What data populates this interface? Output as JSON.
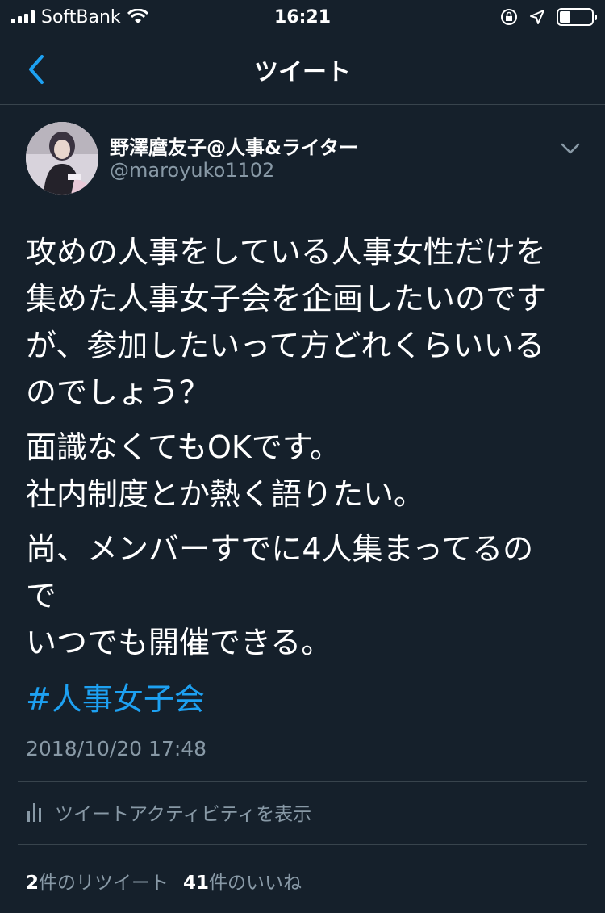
{
  "status_bar": {
    "carrier": "SoftBank",
    "time": "16:21",
    "battery_level": 0.35
  },
  "nav": {
    "title": "ツイート"
  },
  "tweet": {
    "author": {
      "display_name": "野澤麿友子@人事&ライター",
      "handle": "@maroyuko1102"
    },
    "paragraphs": [
      [
        "攻めの人事をしている人事女性だけを",
        "集めた人事女子会を企画したいのです",
        "が、参加したいって方どれくらいいる",
        "のでしょう？"
      ],
      [
        "面識なくてもOKです。",
        "社内制度とか熱く語りたい。"
      ],
      [
        "尚、メンバーすでに4人集まってるの",
        "で",
        "いつでも開催できる。"
      ]
    ],
    "hashtag": "#人事女子会",
    "timestamp": "2018/10/20 17:48",
    "activity_label": "ツイートアクティビティを表示",
    "retweet_count": "2",
    "retweet_label": "件のリツイート",
    "like_count": "41",
    "like_label": "件のいいね"
  },
  "icons": {
    "back": "chevron-left-icon",
    "more": "chevron-down-icon",
    "activity": "bar-chart-icon",
    "wifi": "wifi-icon",
    "orientation_lock": "orientation-lock-icon",
    "location": "location-arrow-icon",
    "battery": "battery-icon"
  },
  "colors": {
    "background": "#15202b",
    "accent": "#1da1f2",
    "secondary_text": "#8899a6",
    "divider": "#38444d"
  }
}
